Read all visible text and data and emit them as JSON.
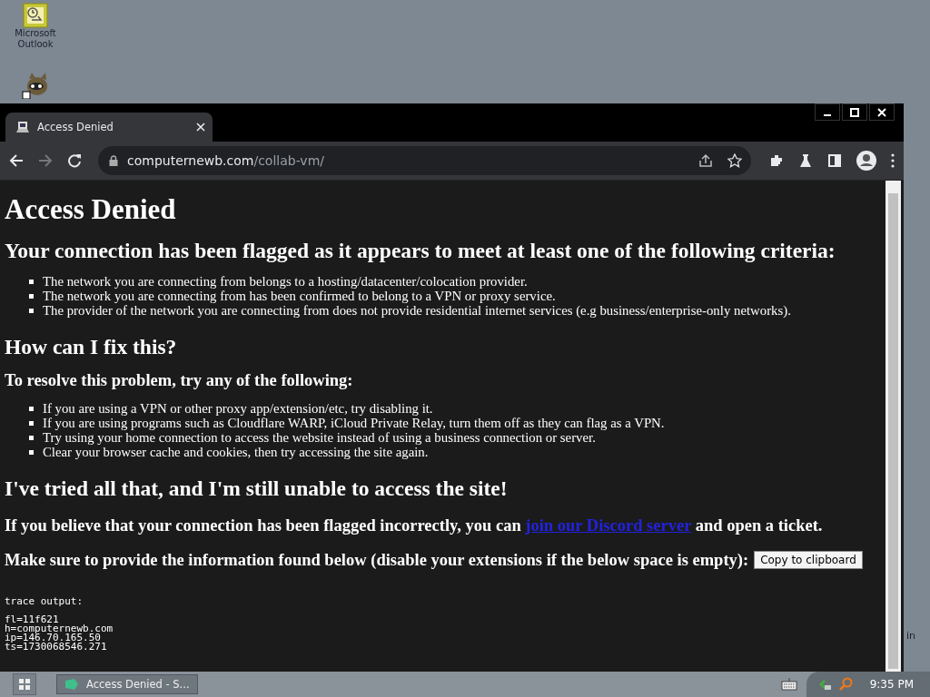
{
  "desktop": {
    "icons": [
      {
        "kind": "outlook",
        "label": "Microsoft Outlook"
      },
      {
        "kind": "raccoon"
      }
    ],
    "edge_label": "in"
  },
  "tabs": [
    {
      "title": "Access Denied",
      "selected": true
    }
  ],
  "address_bar": {
    "domain": "computernewb.com",
    "path": "/collab-vm/"
  },
  "page": {
    "title": "Access Denied",
    "criteria_heading": "Your connection has been flagged as it appears to meet at least one of the following criteria:",
    "criteria": [
      "The network you are connecting from belongs to a hosting/datacenter/colocation provider.",
      "The network you are connecting from has been confirmed to belong to a VPN or proxy service.",
      "The provider of the network you are connecting from does not provide residential internet services (e.g business/enterprise-only networks)."
    ],
    "fix_heading": "How can I fix this?",
    "fix_subheading": "To resolve this problem, try any of the following:",
    "fixes": [
      "If you are using a VPN or other proxy app/extension/etc, try disabling it.",
      "If you are using programs such as Cloudflare WARP, iCloud Private Relay, turn them off as they can flag as a VPN.",
      "Try using your home connection to access the website instead of using a business connection or server.",
      "Clear your browser cache and cookies, then try accessing the site again."
    ],
    "tried_heading": "I've tried all that, and I'm still unable to access the site!",
    "ticket_before": "If you believe that your connection has been flagged incorrectly, you can",
    "ticket_link": "join our Discord server",
    "ticket_after": "and open a ticket.",
    "info_text": "Make sure to provide the information found below (disable your extensions if the below space is empty):",
    "copy_button": "Copy to clipboard",
    "trace_label": "trace output:",
    "trace_lines": [
      "fl=11f621",
      "h=computernewb.com",
      "ip=146.70.165.50",
      "ts=1730068546.271"
    ]
  },
  "taskbar": {
    "task": "Access Denied - S...",
    "clock": "9:35 PM"
  }
}
